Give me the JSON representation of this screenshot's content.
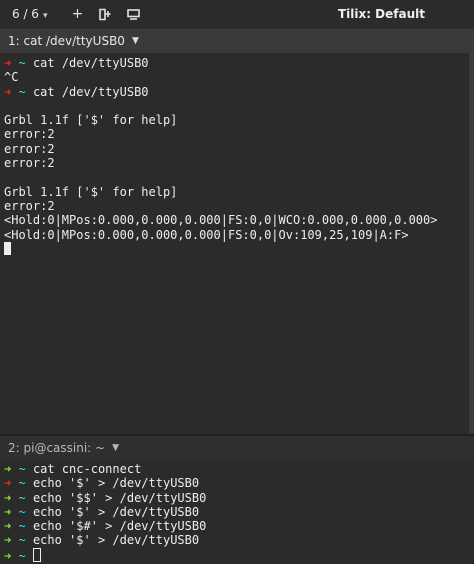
{
  "titlebar": {
    "session_counter": "6 / 6",
    "add_icon": "plus-icon",
    "split_icon": "add-terminal-icon",
    "sync_icon": "broadcast-icon",
    "title": "Tilix: Default"
  },
  "panes": [
    {
      "title": "1: cat /dev/ttyUSB0",
      "lines": [
        {
          "prompt": "red",
          "text": "cat /dev/ttyUSB0"
        },
        {
          "prompt": "",
          "text": "^C"
        },
        {
          "prompt": "red",
          "text": "cat /dev/ttyUSB0"
        },
        {
          "prompt": "",
          "text": ""
        },
        {
          "prompt": "",
          "text": "Grbl 1.1f ['$' for help]"
        },
        {
          "prompt": "",
          "text": "error:2"
        },
        {
          "prompt": "",
          "text": "error:2"
        },
        {
          "prompt": "",
          "text": "error:2"
        },
        {
          "prompt": "",
          "text": ""
        },
        {
          "prompt": "",
          "text": "Grbl 1.1f ['$' for help]"
        },
        {
          "prompt": "",
          "text": "error:2"
        },
        {
          "prompt": "",
          "text": "<Hold:0|MPos:0.000,0.000,0.000|FS:0,0|WCO:0.000,0.000,0.000>"
        },
        {
          "prompt": "",
          "text": "<Hold:0|MPos:0.000,0.000,0.000|FS:0,0|Ov:109,25,109|A:F>"
        }
      ]
    },
    {
      "title": "2: pi@cassini: ~",
      "lines": [
        {
          "prompt": "green",
          "text": "cat cnc-connect"
        },
        {
          "prompt": "red",
          "text": "echo '$' > /dev/ttyUSB0"
        },
        {
          "prompt": "green",
          "text": "echo '$$' > /dev/ttyUSB0"
        },
        {
          "prompt": "green",
          "text": "echo '$' > /dev/ttyUSB0"
        },
        {
          "prompt": "green",
          "text": "echo '$#' > /dev/ttyUSB0"
        },
        {
          "prompt": "green",
          "text": "echo '$' > /dev/ttyUSB0"
        },
        {
          "prompt": "green",
          "text": ""
        }
      ]
    }
  ],
  "prompt": {
    "arrow": "➜",
    "dir": "~"
  },
  "colors": {
    "prompt_red": "#ef2929",
    "prompt_green": "#8ae234",
    "prompt_dir": "#34e2e2"
  }
}
